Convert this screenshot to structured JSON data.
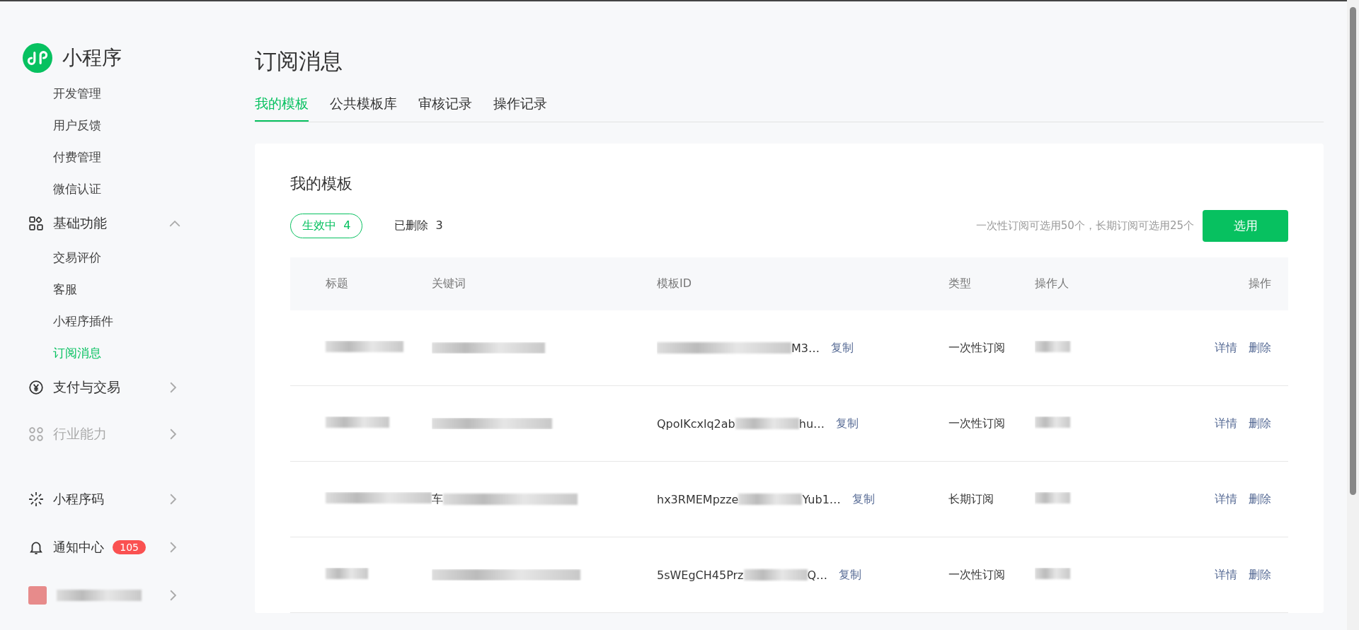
{
  "sidebar": {
    "logo_text": "小程序",
    "items": [
      {
        "kind": "sub",
        "label": "开发管理",
        "selected": false
      },
      {
        "kind": "sub",
        "label": "用户反馈",
        "selected": false
      },
      {
        "kind": "sub",
        "label": "付费管理",
        "selected": false
      },
      {
        "kind": "sub",
        "label": "微信认证",
        "selected": false
      },
      {
        "kind": "group",
        "label": "基础功能",
        "expanded": true,
        "disabled": false
      },
      {
        "kind": "sub",
        "label": "交易评价",
        "selected": false
      },
      {
        "kind": "sub",
        "label": "客服",
        "selected": false
      },
      {
        "kind": "sub",
        "label": "小程序插件",
        "selected": false
      },
      {
        "kind": "sub",
        "label": "订阅消息",
        "selected": true
      },
      {
        "kind": "group",
        "label": "支付与交易",
        "expanded": false,
        "disabled": false
      },
      {
        "kind": "group",
        "label": "行业能力",
        "expanded": false,
        "disabled": true
      }
    ],
    "bottom": [
      {
        "kind": "link",
        "label": "小程序码"
      },
      {
        "kind": "link",
        "label": "通知中心",
        "badge": "105"
      },
      {
        "kind": "account"
      }
    ]
  },
  "page_title": "订阅消息",
  "tabs": [
    {
      "label": "我的模板",
      "selected": true
    },
    {
      "label": "公共模板库",
      "selected": false
    },
    {
      "label": "审核记录",
      "selected": false
    },
    {
      "label": "操作记录",
      "selected": false
    }
  ],
  "card": {
    "title": "我的模板",
    "filters": [
      {
        "label": "生效中",
        "count": "4",
        "selected": true
      },
      {
        "label": "已删除",
        "count": "3",
        "selected": false
      }
    ],
    "hint": "一次性订阅可选用50个，长期订阅可选用25个",
    "select_button": "选用",
    "columns": [
      "标题",
      "关键词",
      "模板ID",
      "类型",
      "操作人",
      "操作"
    ],
    "rows": [
      {
        "keyword_start": "",
        "template_id_start": "",
        "template_id_end": "M3…",
        "copy": "复制",
        "type": "一次性订阅",
        "actions": [
          "详情",
          "删除"
        ]
      },
      {
        "keyword_start": "",
        "template_id_start": "QpoIKcxlq2ab",
        "template_id_end": "hu…",
        "copy": "复制",
        "type": "一次性订阅",
        "actions": [
          "详情",
          "删除"
        ]
      },
      {
        "keyword_start": "车",
        "template_id_start": "hx3RMEMpzze",
        "template_id_end": "Yub1…",
        "copy": "复制",
        "type": "长期订阅",
        "actions": [
          "详情",
          "删除"
        ]
      },
      {
        "keyword_start": "",
        "template_id_start": "5sWEgCH45Prz",
        "template_id_end": "Q…",
        "copy": "复制",
        "type": "一次性订阅",
        "actions": [
          "详情",
          "删除"
        ]
      }
    ]
  }
}
